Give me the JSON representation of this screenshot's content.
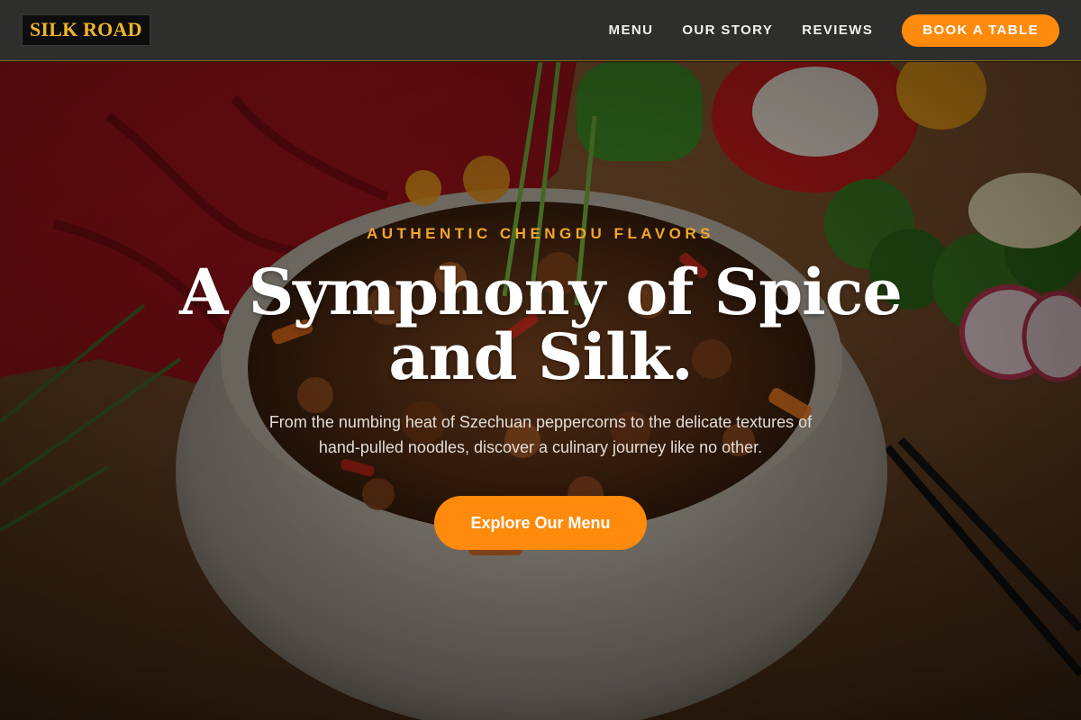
{
  "brand": {
    "name": "SILK ROAD"
  },
  "nav": {
    "links": [
      "MENU",
      "OUR STORY",
      "REVIEWS"
    ],
    "cta_label": "BOOK A TABLE"
  },
  "hero": {
    "eyebrow": "AUTHENTIC CHENGDU FLAVORS",
    "headline_line1": "A Symphony of Spice",
    "headline_line2": "and Silk.",
    "lead_line1": "From the numbing heat of Szechuan peppercorns to the delicate textures of",
    "lead_line2": "hand-pulled noodles, discover a culinary journey like no other.",
    "cta_label": "Explore Our Menu",
    "background_icon": "stir-fry-bowl-photo"
  },
  "colors": {
    "accent": "#ff8a0c",
    "logo_gold": "#f0b429",
    "eyebrow_gold": "#f0a62a",
    "header_bg": "#2e2e2c"
  }
}
